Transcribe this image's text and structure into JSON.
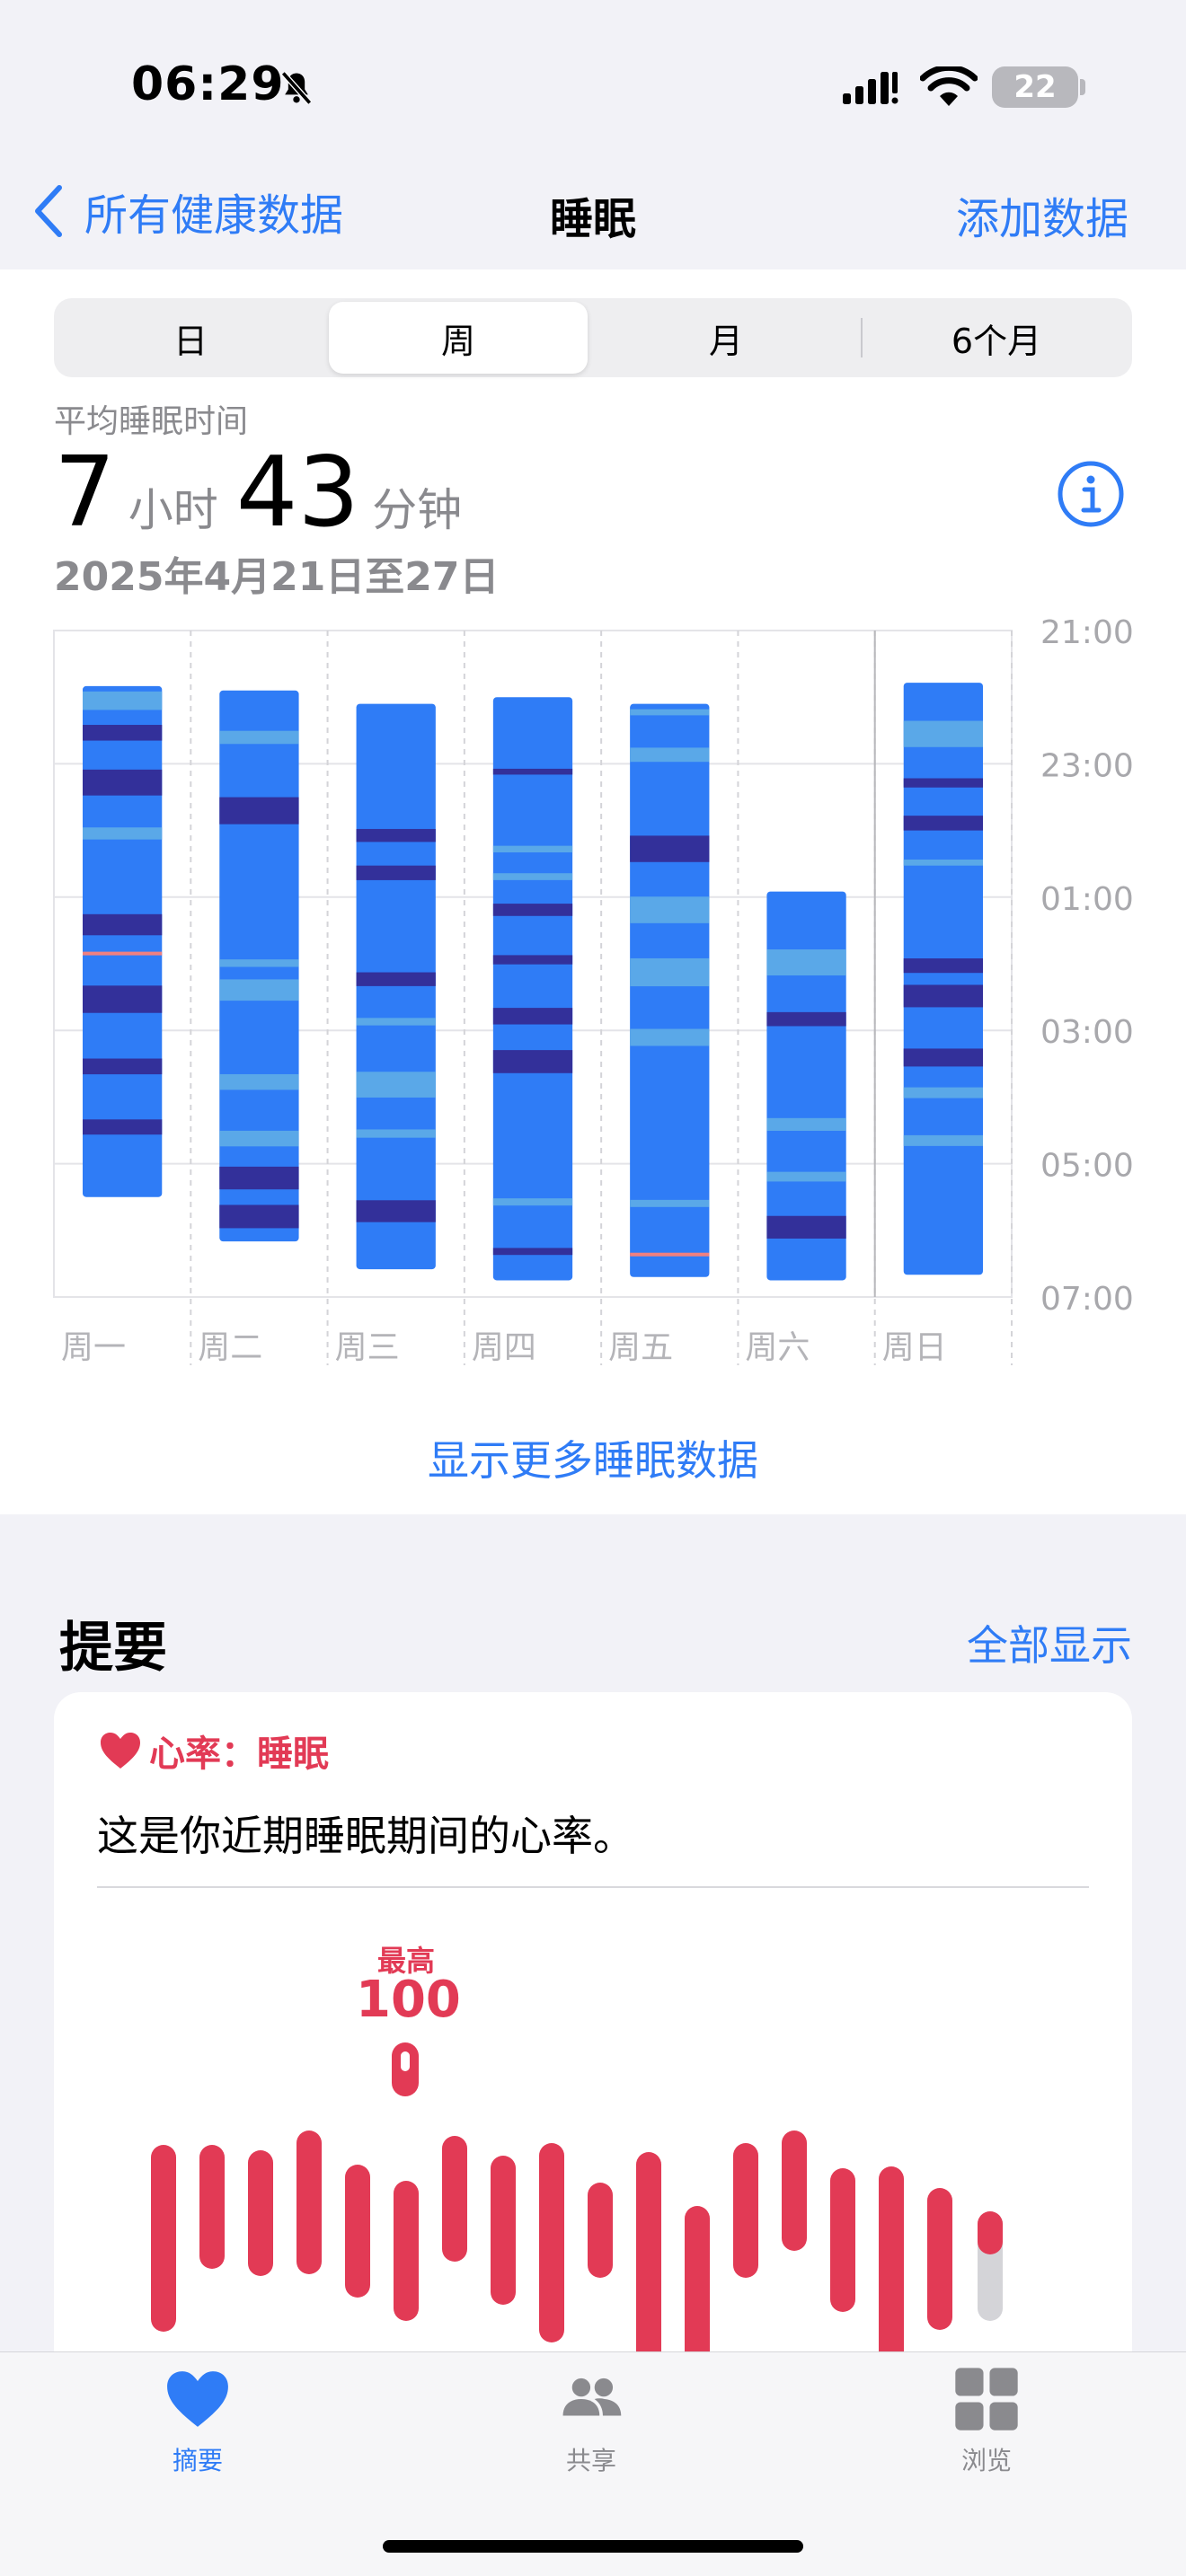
{
  "status_bar": {
    "time": "06:29",
    "battery": "22"
  },
  "nav": {
    "back_label": "所有健康数据",
    "title": "睡眠",
    "action_label": "添加数据"
  },
  "segments": [
    "日",
    "周",
    "月",
    "6个月"
  ],
  "selected_segment": "周",
  "summary_stat": {
    "label": "平均睡眠时间",
    "hours": "7",
    "hours_unit": "小时",
    "minutes": "43",
    "minutes_unit": "分钟",
    "date_range": "2025年4月21日至27日"
  },
  "chart_data": {
    "type": "bar",
    "categories": [
      "周一",
      "周二",
      "周三",
      "周四",
      "周五",
      "周六",
      "周日"
    ],
    "y_tick_labels": [
      "21:00",
      "23:00",
      "01:00",
      "03:00",
      "05:00",
      "07:00"
    ],
    "ylim": [
      "21:00",
      "07:00"
    ],
    "sleep_start": [
      "21:50",
      "21:54",
      "22:06",
      "22:00",
      "22:06",
      "00:55",
      "21:47"
    ],
    "sleep_end": [
      "05:30",
      "06:10",
      "06:35",
      "06:45",
      "06:42",
      "06:45",
      "06:40"
    ],
    "colors": {
      "core": "#2f7cf6",
      "light": "#5aa8e8",
      "deep": "#33309a",
      "awake": "#f08080"
    }
  },
  "more_link": "显示更多睡眠数据",
  "highlights": {
    "title": "提要",
    "show_all": "全部显示",
    "card": {
      "category": "心率：睡眠",
      "description": "这是你近期睡眠期间的心率。",
      "max_label": "最高",
      "max_value": "100"
    }
  },
  "tabs": [
    {
      "label": "摘要",
      "icon": "heart-icon",
      "active": true
    },
    {
      "label": "共享",
      "icon": "people-icon",
      "active": false
    },
    {
      "label": "浏览",
      "icon": "grid-icon",
      "active": false
    }
  ]
}
